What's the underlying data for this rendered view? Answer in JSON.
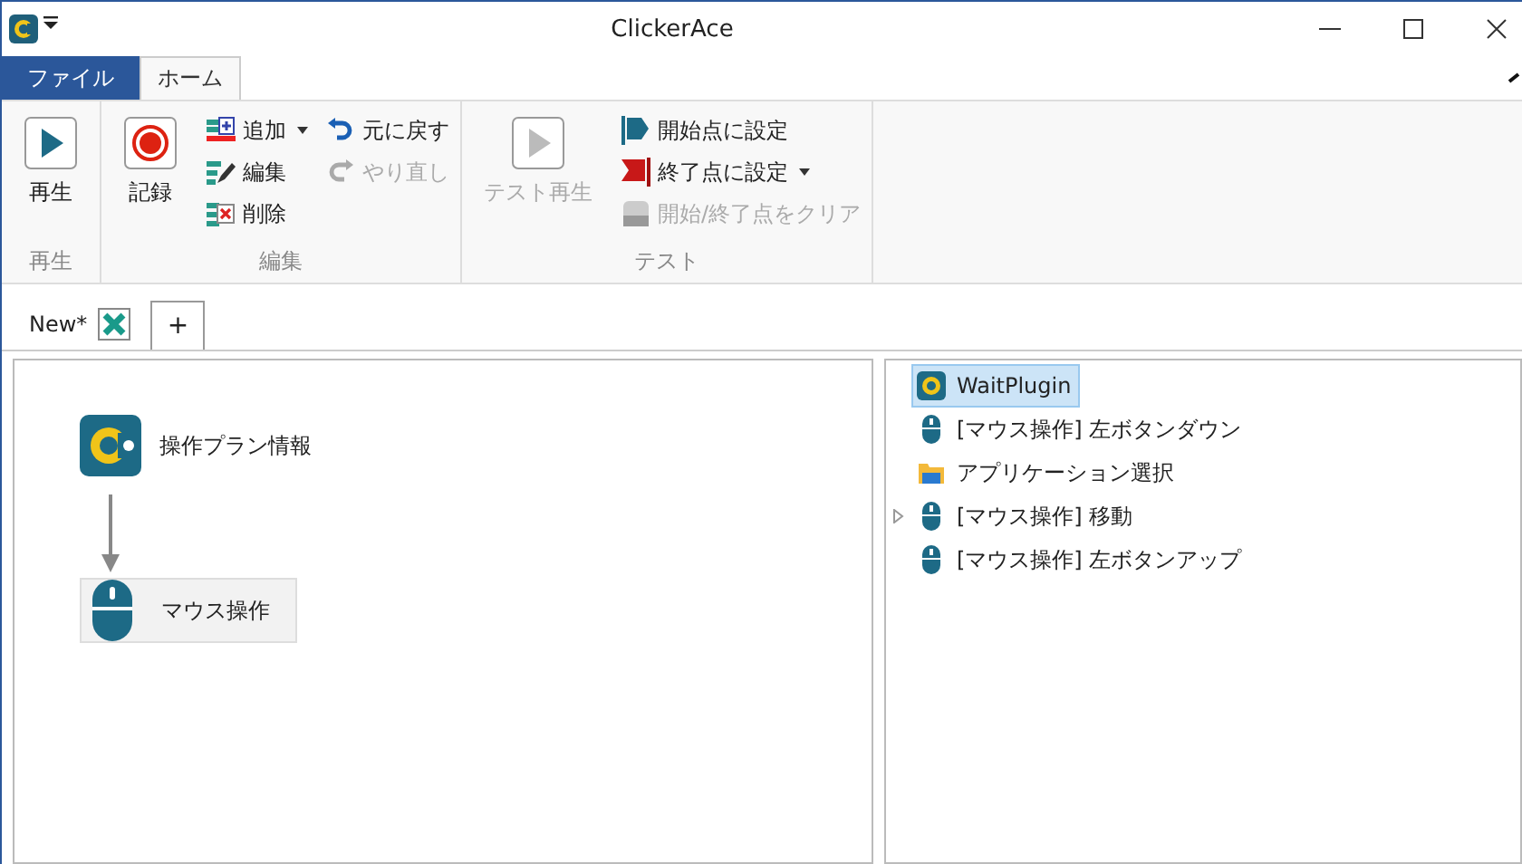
{
  "window": {
    "title": "ClickerAce"
  },
  "ribbon_tabs": [
    {
      "label": "ファイル",
      "kind": "file",
      "selected": false
    },
    {
      "label": "ホーム",
      "kind": "tab",
      "selected": true
    }
  ],
  "ribbon_groups": [
    {
      "label": "再生",
      "items": [
        {
          "kind": "play",
          "label": "再生",
          "disabled": false
        }
      ]
    },
    {
      "label": "編集",
      "items": [
        {
          "kind": "record",
          "label": "記録",
          "disabled": false
        },
        {
          "kind": "add",
          "label": "追加",
          "dropdown": true,
          "disabled": false
        },
        {
          "kind": "edit",
          "label": "編集",
          "dropdown": false,
          "disabled": false
        },
        {
          "kind": "delete",
          "label": "削除",
          "dropdown": false,
          "disabled": false
        },
        {
          "kind": "undo",
          "label": "元に戻す",
          "dropdown": false,
          "disabled": false
        },
        {
          "kind": "redo",
          "label": "やり直し",
          "dropdown": false,
          "disabled": true
        }
      ]
    },
    {
      "label": "テスト",
      "items": [
        {
          "kind": "play",
          "label": "テスト再生",
          "disabled": true
        },
        {
          "kind": "start",
          "label": "開始点に設定",
          "dropdown": false,
          "disabled": false
        },
        {
          "kind": "end",
          "label": "終了点に設定",
          "dropdown": true,
          "disabled": false
        },
        {
          "kind": "clear",
          "label": "開始/終了点をクリア",
          "dropdown": false,
          "disabled": true
        }
      ]
    }
  ],
  "doc_tabs": [
    {
      "label": "New*",
      "selected": true
    }
  ],
  "add_tab": {
    "label": "+"
  },
  "flow_nodes": [
    {
      "kind": "plugin",
      "label": "操作プラン情報",
      "selected": false
    },
    {
      "kind": "mouse",
      "label": "マウス操作",
      "selected": true
    }
  ],
  "tree": [
    {
      "kind": "plugin",
      "label": "WaitPlugin",
      "selected": true,
      "expandable": false
    },
    {
      "kind": "mouse",
      "label": "[マウス操作] 左ボタンダウン",
      "selected": false,
      "expandable": false
    },
    {
      "kind": "folder",
      "label": "アプリケーション選択",
      "selected": false,
      "expandable": false
    },
    {
      "kind": "mouse",
      "label": "[マウス操作] 移動",
      "selected": false,
      "expandable": true
    },
    {
      "kind": "mouse",
      "label": "[マウス操作] 左ボタンアップ",
      "selected": false,
      "expandable": false
    }
  ]
}
